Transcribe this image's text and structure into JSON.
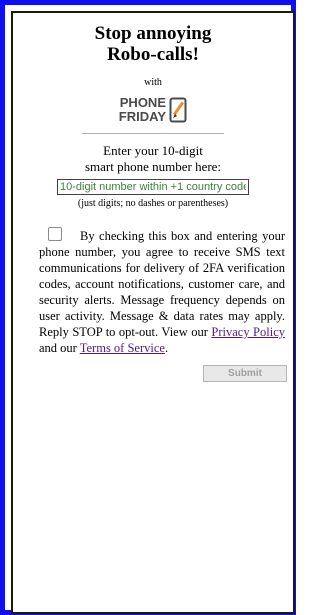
{
  "header": {
    "title_line1": "Stop annoying",
    "title_line2": "Robo-calls!",
    "with_text": "with"
  },
  "logo": {
    "line1": "PHONE",
    "line2": "FRIDAY",
    "icon": "phone-pencil-icon",
    "brand_color": "#f28c28"
  },
  "form": {
    "prompt_line1": "Enter your 10-digit",
    "prompt_line2": "smart phone number here:",
    "phone_placeholder": "10-digit number within +1 country code",
    "phone_value": "",
    "hint": "(just digits; no dashes or parentheses)"
  },
  "consent": {
    "checked": false,
    "text": "By checking this box and entering your phone number, you agree to receive SMS text communications for delivery of 2FA verification codes, account notifications, customer care, and security alerts. Message frequency depends on user activity. Message & data rates may apply. Reply STOP to opt-out. View our",
    "privacy_link": "Privacy Policy",
    "and_text": "and our",
    "terms_link": "Terms of Service",
    "end_text": "."
  },
  "submit": {
    "label": "Submit",
    "disabled": true
  },
  "colors": {
    "outer_border": "#1010ee",
    "link": "#551a8b",
    "placeholder": "#3f7f3f"
  }
}
